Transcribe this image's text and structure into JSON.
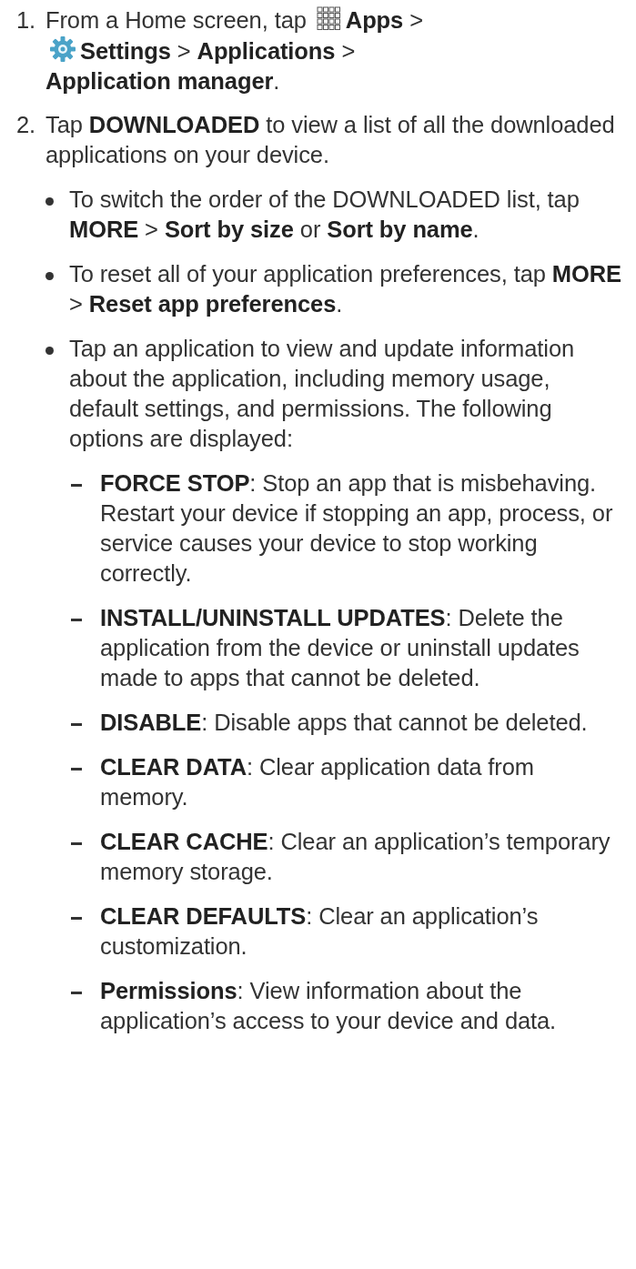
{
  "steps": [
    {
      "number": "1.",
      "segments": [
        {
          "kind": "text",
          "text": "From a Home screen, tap"
        },
        {
          "kind": "apps_icon"
        },
        {
          "kind": "text",
          "text": "**Apps** >"
        },
        {
          "kind": "break"
        },
        {
          "kind": "settings_icon"
        },
        {
          "kind": "text",
          "text": "**Settings** > **Applications** >"
        },
        {
          "kind": "break"
        },
        {
          "kind": "text",
          "text": "**Application manager**."
        }
      ]
    },
    {
      "number": "2.",
      "segments": [
        {
          "kind": "text",
          "text": "Tap **DOWNLOADED** to view a list of all the downloaded applications on your device."
        }
      ],
      "bullets": [
        {
          "text": "To switch the order of the DOWNLOADED list, tap **MORE** > **Sort by size** or **Sort by name**."
        },
        {
          "text": "To reset all of your application preferences, tap **MORE** > **Reset app preferences**."
        },
        {
          "text": "Tap an application to view and update information about the application, including memory usage, default settings, and permissions. The following options are displayed:",
          "options": [
            {
              "text": "**FORCE STOP**: Stop an app that is misbehaving. Restart your device if stopping an app, process, or service causes your device to stop working correctly."
            },
            {
              "text": "**INSTALL/UNINSTALL UPDATES**: Delete the application from the device or uninstall updates made to apps that cannot be deleted."
            },
            {
              "text": "**DISABLE**: Disable apps that cannot be deleted."
            },
            {
              "text": "**CLEAR DATA**: Clear application data from memory."
            },
            {
              "text": "**CLEAR CACHE**: Clear an application’s temporary memory storage."
            },
            {
              "text": "**CLEAR DEFAULTS**: Clear an application’s customization."
            },
            {
              "text": "**Permissions**: View information about the application’s access to your device and data."
            }
          ]
        }
      ]
    }
  ]
}
